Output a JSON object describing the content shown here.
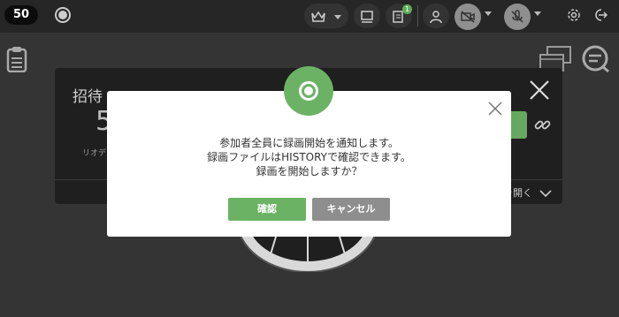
{
  "topbar": {
    "participant_count": "50",
    "notification_count": "1"
  },
  "background_panel": {
    "title": "招待",
    "big_number": "5",
    "small_text": "リオデ",
    "expand_label": "を開く"
  },
  "dialog": {
    "message_lines": [
      "参加者全員に録画開始を通知します。",
      "録画ファイルはHISTORYで確認できます。",
      "録画を開始しますか？"
    ],
    "confirm_label": "確認",
    "cancel_label": "キャンセル"
  },
  "colors": {
    "accent_green": "#6cb265",
    "cancel_gray": "#8e8e8e",
    "topbar_bg": "#262626",
    "page_bg": "#343434"
  },
  "icons": [
    "record-icon",
    "crown-icon",
    "screen-icon",
    "document-list-icon",
    "user-icon",
    "camera-off-icon",
    "mic-off-icon",
    "gear-icon",
    "exit-icon",
    "clipboard-icon",
    "windows-icon",
    "chat-search-icon",
    "link-icon",
    "close-icon"
  ]
}
